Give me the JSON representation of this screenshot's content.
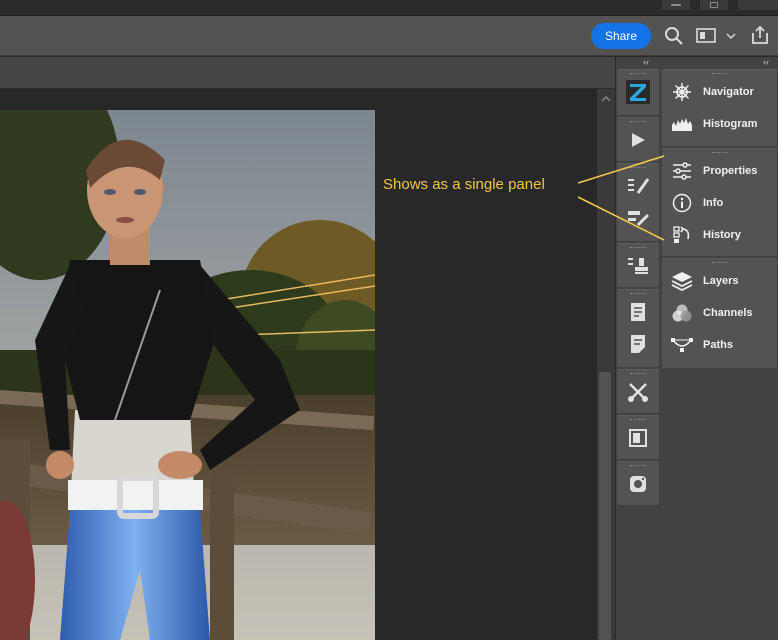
{
  "header": {
    "share_label": "Share"
  },
  "panels": {
    "groups": [
      [
        {
          "label": "Navigator",
          "icon": "navigator-icon"
        },
        {
          "label": "Histogram",
          "icon": "histogram-icon"
        }
      ],
      [
        {
          "label": "Properties",
          "icon": "properties-icon"
        },
        {
          "label": "Info",
          "icon": "info-icon"
        },
        {
          "label": "History",
          "icon": "history-icon"
        }
      ],
      [
        {
          "label": "Layers",
          "icon": "layers-icon"
        },
        {
          "label": "Channels",
          "icon": "channels-icon"
        },
        {
          "label": "Paths",
          "icon": "paths-icon"
        }
      ]
    ]
  },
  "dock_icons": [
    "zoom-plugin-icon",
    "play-actions-icon",
    "brush-settings-icon",
    "brush-presets-icon",
    "clone-source-icon",
    "notes-icon",
    "comments-icon",
    "tool-presets-icon",
    "libraries-icon",
    "instagram-icon"
  ],
  "annotation": {
    "text": "Shows as a single panel",
    "color": "#f2c84b"
  },
  "colors": {
    "accent": "#1473e6",
    "panel_bg": "#535353",
    "canvas_bg": "#282828"
  }
}
